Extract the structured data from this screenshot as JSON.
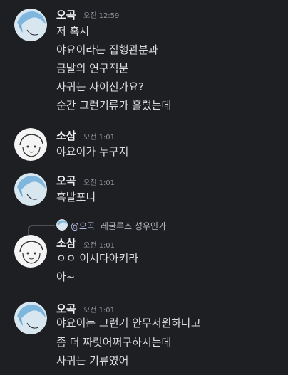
{
  "users": {
    "okok": {
      "name": "오곡",
      "avatar_icon": "blue-hair-avatar-icon"
    },
    "sosam": {
      "name": "소삼",
      "avatar_icon": "sketch-avatar-icon"
    }
  },
  "messages": [
    {
      "author": "오곡",
      "timestamp": "오전 12:59",
      "lines": [
        "저 혹시",
        "야요이라는 집행관분과",
        "금발의 연구직분",
        "사귀는 사이신가요?",
        "순간 그런기류가 흘렀는데"
      ]
    },
    {
      "author": "소삼",
      "timestamp": "오전 1:01",
      "lines": [
        "야요이가 누구지"
      ]
    },
    {
      "author": "오곡",
      "timestamp": "오전 1:01",
      "lines": [
        "흑발포니"
      ]
    },
    {
      "reply": {
        "mention": "@오곡",
        "text": "레굴루스 성우인가"
      },
      "author": "소삼",
      "timestamp": "오전 1:01",
      "lines": [
        "ㅇㅇ 이시다아키라",
        "아~"
      ]
    },
    {
      "author": "오곡",
      "timestamp": "오전 1:01",
      "lines": [
        "야요이는 그런거 안무서원하다고",
        "좀 더 짜릿어쩌구하시는데",
        "사귀는 기류였어"
      ]
    }
  ],
  "colors": {
    "background": "#1e1f23",
    "new_divider": "#c33c3f"
  }
}
